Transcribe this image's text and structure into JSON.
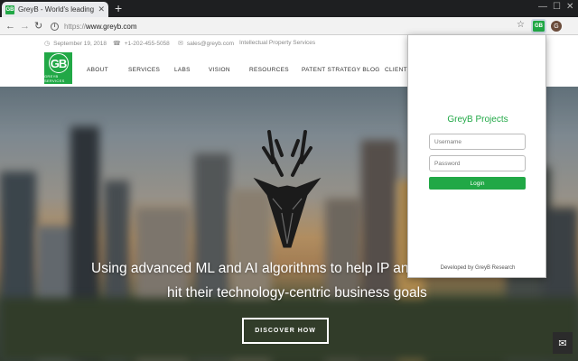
{
  "browser": {
    "tab_title": "GreyB - World's leading te",
    "tab_favicon": "GB",
    "new_tab": "+",
    "url_scheme": "https://",
    "url_host": "www.greyb.com",
    "extension_label": "GB",
    "profile_initial": "G",
    "icons": [
      "back-arrow-icon",
      "forward-arrow-icon",
      "reload-icon",
      "info-icon",
      "star-icon",
      "menu-dots-icon"
    ]
  },
  "infobar": {
    "date": "September 19, 2018",
    "phone": "+1-202-455-5058",
    "email": "sales@greyb.com",
    "tagline": "Intellectual Property Services"
  },
  "site": {
    "logo_text": "GB",
    "logo_sub": "GREYB SERVICES",
    "nav": [
      "ABOUT",
      "SERVICES",
      "LABS",
      "VISION",
      "RESOURCES",
      "PATENT STRATEGY BLOG",
      "CLIENT S"
    ]
  },
  "hero": {
    "line1": "Using advanced ML and AI algorithms to help IP and R&",
    "line2": "hit their technology-centric business goals",
    "cta": "DISCOVER HOW"
  },
  "popup": {
    "title": "GreyB Projects",
    "username_placeholder": "Username",
    "password_placeholder": "Password",
    "login_label": "Login",
    "footer": "Developed by GreyB Research"
  },
  "colors": {
    "brand_green": "#21a846",
    "chrome_dark": "#1e1f21",
    "toolbar": "#f2f2f2"
  }
}
